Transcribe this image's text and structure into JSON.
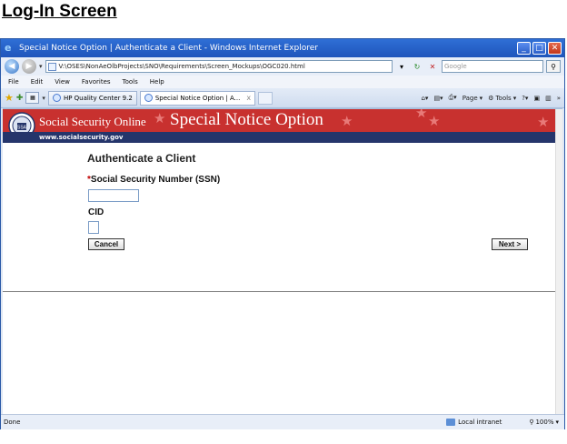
{
  "page_heading": "Log-In Screen",
  "window": {
    "title": "Special Notice Option | Authenticate a Client - Windows Internet Explorer",
    "address": "V:\\OSES\\NonAeOlbProjects\\SNO\\Requirements\\Screen_Mockups\\OGC020.html",
    "search_placeholder": "Google"
  },
  "menu": [
    "File",
    "Edit",
    "View",
    "Favorites",
    "Tools",
    "Help"
  ],
  "tabs": [
    {
      "label": "HP Quality Center 9.2"
    },
    {
      "label": "Special Notice Option | A...",
      "close": "x"
    }
  ],
  "command_bar": {
    "page": "Page",
    "tools": "Tools"
  },
  "banner": {
    "site_name": "Social Security Online",
    "app_title": "Special Notice Option",
    "url": "www.socialsecurity.gov",
    "seal_text": "SSA"
  },
  "form": {
    "title": "Authenticate a Client",
    "ssn_required_mark": "*",
    "ssn_label": "Social Security Number (SSN)",
    "cid_label": "CID",
    "cancel_label": "Cancel",
    "next_label": "Next >"
  },
  "status": {
    "done": "Done",
    "zone": "Local intranet",
    "zoom": "100%"
  },
  "colors": {
    "banner_red": "#c8312f",
    "banner_navy": "#25356b",
    "required_red": "#c00000"
  }
}
